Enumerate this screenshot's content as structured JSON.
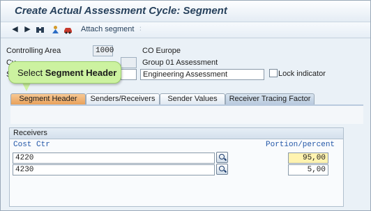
{
  "window": {
    "title": "Create Actual Assessment Cycle: Segment"
  },
  "toolbar": {
    "icons": [
      "arrow-left-icon",
      "arrow-right-icon",
      "binoculars-icon",
      "person-icon",
      "car-icon"
    ],
    "attach_segment": "Attach segment"
  },
  "header": {
    "controlling_area": {
      "label": "Controlling Area",
      "value": "1000",
      "desc": "CO Europe"
    },
    "cycle": {
      "label": "Cy",
      "value": "",
      "desc": "Group 01 Assessment"
    },
    "segment": {
      "label": "Se",
      "value": "",
      "desc": "Engineering Assessment"
    },
    "lock_indicator": "Lock indicator"
  },
  "tooltip": {
    "prefix": "Select ",
    "bold": "Segment Header"
  },
  "tabs": [
    "Segment Header",
    "Senders/Receivers",
    "Sender Values",
    "Receiver Tracing Factor"
  ],
  "receivers": {
    "title": "Receivers",
    "col_cost_ctr": "Cost Ctr",
    "col_portion": "Portion/percent",
    "rows": [
      {
        "cost_ctr": "4220",
        "portion": "95,00"
      },
      {
        "cost_ctr": "4230",
        "portion": "5,00"
      }
    ]
  }
}
